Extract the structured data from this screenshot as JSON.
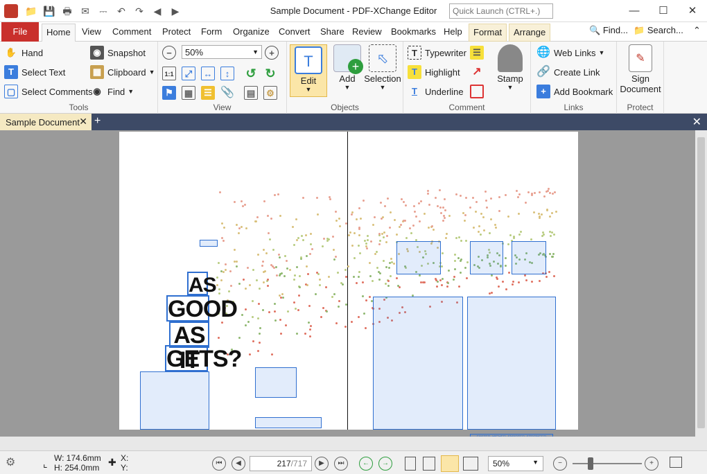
{
  "window": {
    "title": "Sample Document - PDF-XChange Editor",
    "quick_launch_placeholder": "Quick Launch (CTRL+.)"
  },
  "tabs": [
    {
      "label": "File"
    },
    {
      "label": "Home"
    },
    {
      "label": "View"
    },
    {
      "label": "Comment"
    },
    {
      "label": "Protect"
    },
    {
      "label": "Form"
    },
    {
      "label": "Organize"
    },
    {
      "label": "Convert"
    },
    {
      "label": "Share"
    },
    {
      "label": "Review"
    },
    {
      "label": "Bookmarks"
    },
    {
      "label": "Help"
    },
    {
      "label": "Format"
    },
    {
      "label": "Arrange"
    }
  ],
  "tab_right": {
    "find": "Find...",
    "search": "Search..."
  },
  "ribbon": {
    "tools": {
      "label": "Tools",
      "hand": "Hand",
      "select_text": "Select Text",
      "select_comments": "Select Comments",
      "snapshot": "Snapshot",
      "clipboard": "Clipboard",
      "find": "Find"
    },
    "view": {
      "label": "View",
      "zoom_value": "50%"
    },
    "objects": {
      "label": "Objects",
      "edit": "Edit",
      "add": "Add",
      "selection": "Selection"
    },
    "comment": {
      "label": "Comment",
      "typewriter": "Typewriter",
      "highlight": "Highlight",
      "underline": "Underline",
      "stamp": "Stamp"
    },
    "links": {
      "label": "Links",
      "web_links": "Web Links",
      "create_link": "Create Link",
      "add_bookmark": "Add Bookmark"
    },
    "protect": {
      "label": "Protect",
      "sign_document_line1": "Sign",
      "sign_document_line2": "Document"
    }
  },
  "document_tab": {
    "label": "Sample Document"
  },
  "page_content": {
    "headline": [
      "AS",
      "GOOD",
      "AS IT",
      "GETS?"
    ],
    "footer_caption": "FASTER, HIGHER, SMARTER, STRONGER"
  },
  "statusbar": {
    "width": "W: 174.6mm",
    "height": "H: 254.0mm",
    "x_label": "X:",
    "y_label": "Y:",
    "page_current": "217",
    "page_total": "/717",
    "zoom": "50%"
  },
  "colors": {
    "file_tab": "#c9302c",
    "doc_tabbar": "#3d4a66",
    "doc_tab_active": "#f5e9c2",
    "highlight_blue": "#2f6fd0"
  }
}
